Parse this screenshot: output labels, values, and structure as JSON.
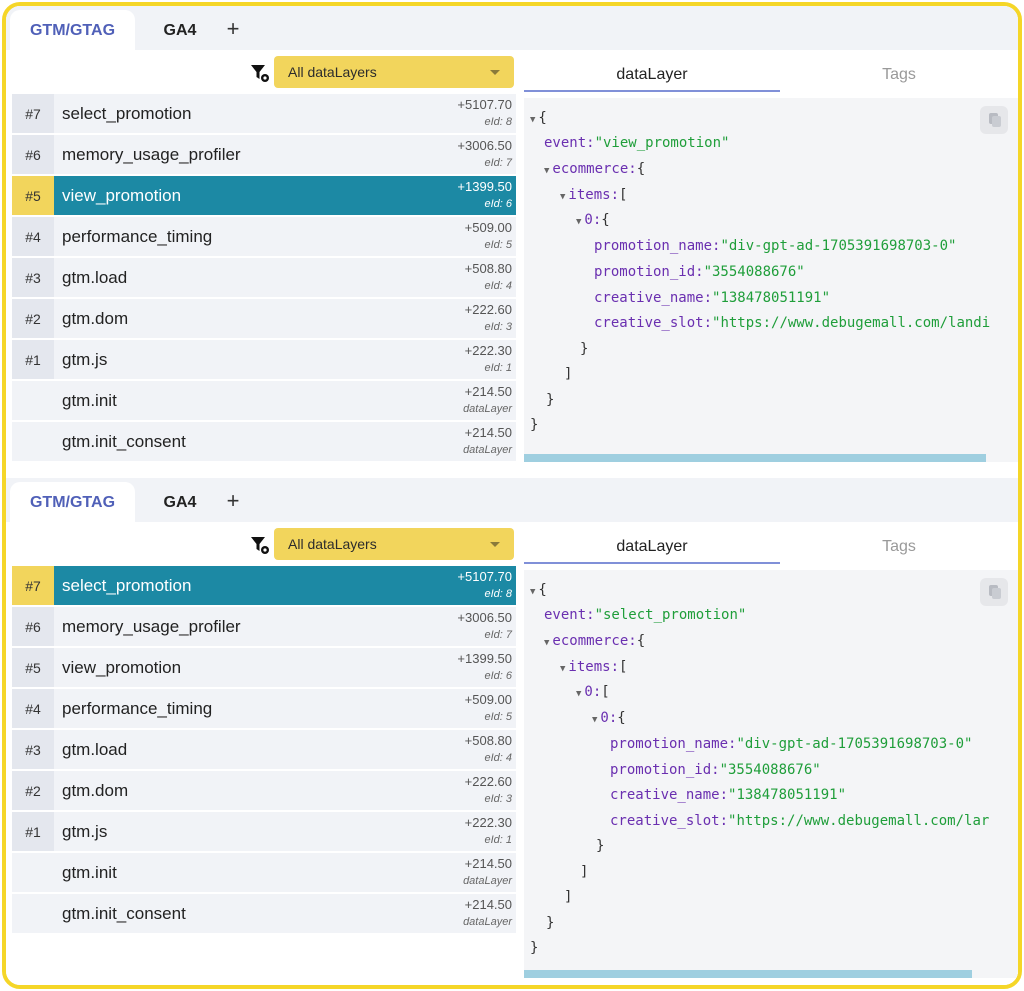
{
  "panels": [
    {
      "tabs": {
        "gtm": "GTM/GTAG",
        "ga4": "GA4",
        "add": "+"
      },
      "filter": {
        "label": "All dataLayers"
      },
      "events": [
        {
          "num": "#7",
          "name": "select_promotion",
          "time": "+5107.70",
          "eid": "eId: 8"
        },
        {
          "num": "#6",
          "name": "memory_usage_profiler",
          "time": "+3006.50",
          "eid": "eId: 7"
        },
        {
          "num": "#5",
          "name": "view_promotion",
          "time": "+1399.50",
          "eid": "eId: 6"
        },
        {
          "num": "#4",
          "name": "performance_timing",
          "time": "+509.00",
          "eid": "eId: 5"
        },
        {
          "num": "#3",
          "name": "gtm.load",
          "time": "+508.80",
          "eid": "eId: 4"
        },
        {
          "num": "#2",
          "name": "gtm.dom",
          "time": "+222.60",
          "eid": "eId: 3"
        },
        {
          "num": "#1",
          "name": "gtm.js",
          "time": "+222.30",
          "eid": "eId: 1"
        },
        {
          "num": "",
          "name": "gtm.init",
          "time": "+214.50",
          "eid": "dataLayer"
        },
        {
          "num": "",
          "name": "gtm.init_consent",
          "time": "+214.50",
          "eid": "dataLayer"
        }
      ],
      "right_tabs": {
        "datalayer": "dataLayer",
        "tags": "Tags"
      },
      "code": {
        "event_key": "event:",
        "event_val": "\"view_promotion\"",
        "ecommerce_key": "ecommerce:",
        "items_key": "items:",
        "index0": "0:",
        "promotion_name_key": "promotion_name:",
        "promotion_name_val": "\"div-gpt-ad-1705391698703-0\"",
        "promotion_id_key": "promotion_id:",
        "promotion_id_val": "\"3554088676\"",
        "creative_name_key": "creative_name:",
        "creative_name_val": "\"138478051191\"",
        "creative_slot_key": "creative_slot:",
        "creative_slot_val": "\"https://www.debugemall.com/landi"
      }
    },
    {
      "tabs": {
        "gtm": "GTM/GTAG",
        "ga4": "GA4",
        "add": "+"
      },
      "filter": {
        "label": "All dataLayers"
      },
      "events": [
        {
          "num": "#7",
          "name": "select_promotion",
          "time": "+5107.70",
          "eid": "eId: 8"
        },
        {
          "num": "#6",
          "name": "memory_usage_profiler",
          "time": "+3006.50",
          "eid": "eId: 7"
        },
        {
          "num": "#5",
          "name": "view_promotion",
          "time": "+1399.50",
          "eid": "eId: 6"
        },
        {
          "num": "#4",
          "name": "performance_timing",
          "time": "+509.00",
          "eid": "eId: 5"
        },
        {
          "num": "#3",
          "name": "gtm.load",
          "time": "+508.80",
          "eid": "eId: 4"
        },
        {
          "num": "#2",
          "name": "gtm.dom",
          "time": "+222.60",
          "eid": "eId: 3"
        },
        {
          "num": "#1",
          "name": "gtm.js",
          "time": "+222.30",
          "eid": "eId: 1"
        },
        {
          "num": "",
          "name": "gtm.init",
          "time": "+214.50",
          "eid": "dataLayer"
        },
        {
          "num": "",
          "name": "gtm.init_consent",
          "time": "+214.50",
          "eid": "dataLayer"
        }
      ],
      "right_tabs": {
        "datalayer": "dataLayer",
        "tags": "Tags"
      },
      "code": {
        "event_key": "event:",
        "event_val": "\"select_promotion\"",
        "ecommerce_key": "ecommerce:",
        "items_key": "items:",
        "index0": "0:",
        "promotion_name_key": "promotion_name:",
        "promotion_name_val": "\"div-gpt-ad-1705391698703-0\"",
        "promotion_id_key": "promotion_id:",
        "promotion_id_val": "\"3554088676\"",
        "creative_name_key": "creative_name:",
        "creative_name_val": "\"138478051191\"",
        "creative_slot_key": "creative_slot:",
        "creative_slot_val": "\"https://www.debugemall.com/lar"
      }
    }
  ],
  "colors": {
    "accent_yellow": "#f2d55c",
    "selected_row": "#1c89a4",
    "tab_active": "#5060b8",
    "frame_border": "#f5d628"
  }
}
